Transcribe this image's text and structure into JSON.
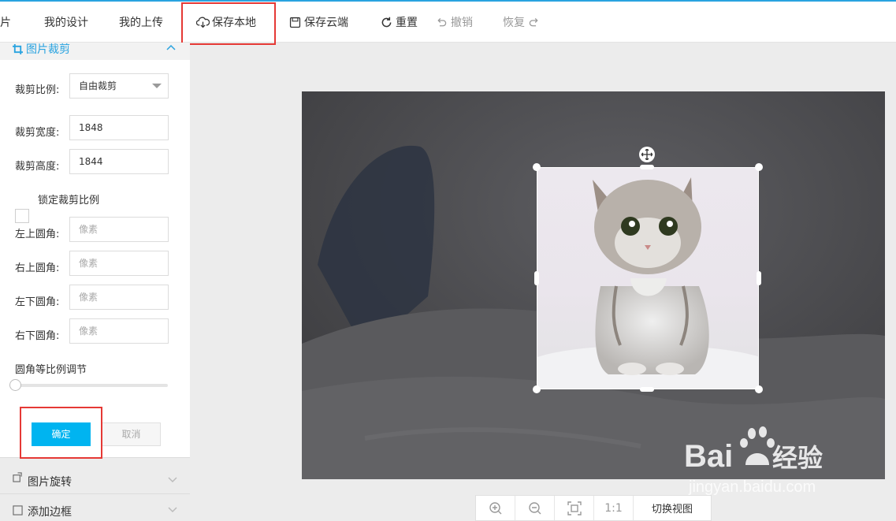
{
  "toolbar": {
    "items": [
      {
        "label": "片"
      },
      {
        "label": "我的设计"
      },
      {
        "label": "我的上传"
      },
      {
        "label": "保存本地",
        "icon": "cloud-download-icon"
      },
      {
        "label": "保存云端",
        "icon": "save-icon"
      },
      {
        "label": "重置",
        "icon": "refresh-icon"
      },
      {
        "label": "撤销",
        "icon": "undo-icon",
        "disabled": true
      },
      {
        "label": "恢复",
        "icon": "redo-icon",
        "disabled": true
      }
    ]
  },
  "panel": {
    "title": "图片裁剪",
    "crop_ratio": {
      "label": "裁剪比例:",
      "value": "自由裁剪"
    },
    "crop_width": {
      "label": "裁剪宽度:",
      "value": "1848"
    },
    "crop_height": {
      "label": "裁剪高度:",
      "value": "1844"
    },
    "lock_ratio": {
      "label": "锁定裁剪比例",
      "checked": false
    },
    "corner_tl": {
      "label": "左上圆角:",
      "placeholder": "像素"
    },
    "corner_tr": {
      "label": "右上圆角:",
      "placeholder": "像素"
    },
    "corner_bl": {
      "label": "左下圆角:",
      "placeholder": "像素"
    },
    "corner_br": {
      "label": "右下圆角:",
      "placeholder": "像素"
    },
    "slider": {
      "label": "圆角等比例调节",
      "value": 0
    },
    "ok_label": "确定",
    "cancel_label": "取消",
    "sections": [
      {
        "label": "图片旋转",
        "icon": "rotate-icon"
      },
      {
        "label": "添加边框",
        "icon": "border-icon"
      }
    ]
  },
  "zoombar": {
    "items": [
      "zoom-in-icon",
      "zoom-out-icon",
      "fit-icon",
      "1:1",
      "切换视图"
    ]
  },
  "watermark": {
    "text": "Bai 经验",
    "url": "jingyan.baidu.com"
  },
  "colors": {
    "accent": "#29a3e0",
    "primary_button": "#00b4f0",
    "highlight": "#e53935"
  }
}
